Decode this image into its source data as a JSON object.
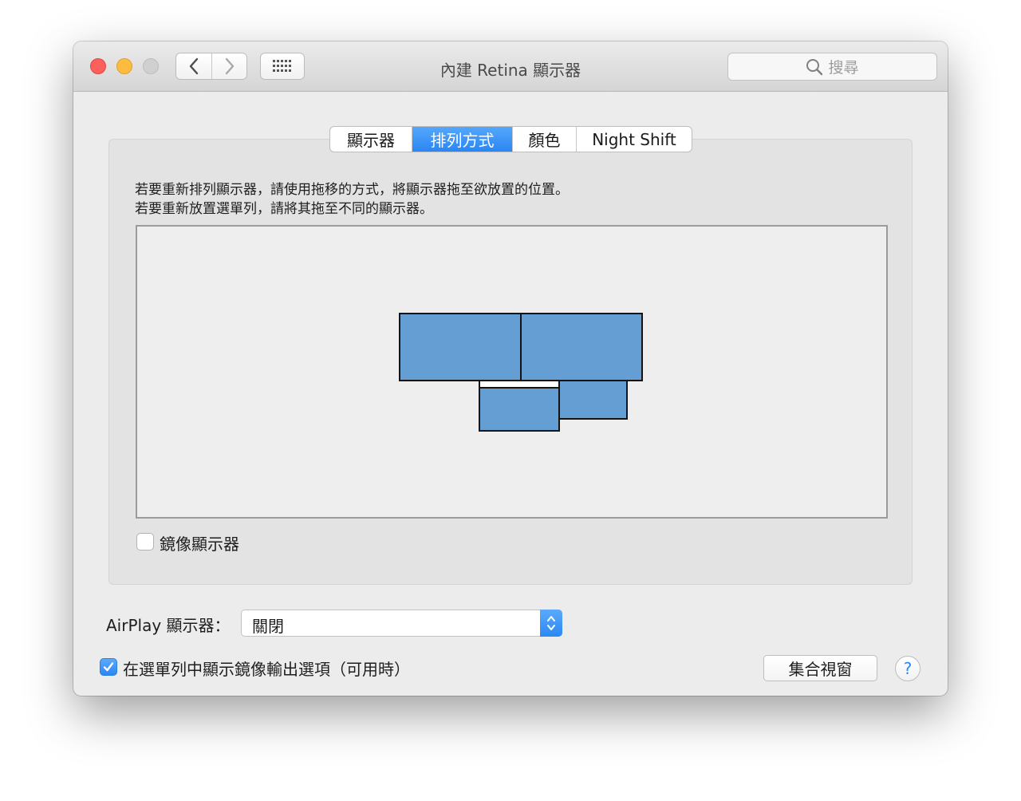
{
  "window": {
    "title": "內建 Retina 顯示器"
  },
  "toolbar": {
    "back_icon": "chevron-left-icon",
    "forward_icon": "chevron-right-icon",
    "show_all_icon": "grid-icon"
  },
  "search": {
    "placeholder": "搜尋",
    "icon": "magnifier-icon"
  },
  "tabs": [
    {
      "label": "顯示器",
      "active": false
    },
    {
      "label": "排列方式",
      "active": true
    },
    {
      "label": "顏色",
      "active": false
    },
    {
      "label": "Night Shift",
      "active": false
    }
  ],
  "arrangement": {
    "instruction_line1": "若要重新排列顯示器，請使用拖移的方式，將顯示器拖至欲放置的位置。",
    "instruction_line2": "若要重新放置選單列，請將其拖至不同的顯示器。",
    "display_color": "#649ed3",
    "display_count": 4
  },
  "mirror": {
    "label": "鏡像顯示器",
    "checked": false
  },
  "airplay": {
    "label": "AirPlay 顯示器：",
    "value": "關閉"
  },
  "menubar_option": {
    "label": "在選單列中顯示鏡像輸出選項（可用時）",
    "checked": true
  },
  "buttons": {
    "gather_windows": "集合視窗",
    "help": "?"
  },
  "colors": {
    "accent": "#2b87f3",
    "close": "#fc605c",
    "minimize": "#fdbc40",
    "zoom_disabled": "#d0d0d0"
  }
}
